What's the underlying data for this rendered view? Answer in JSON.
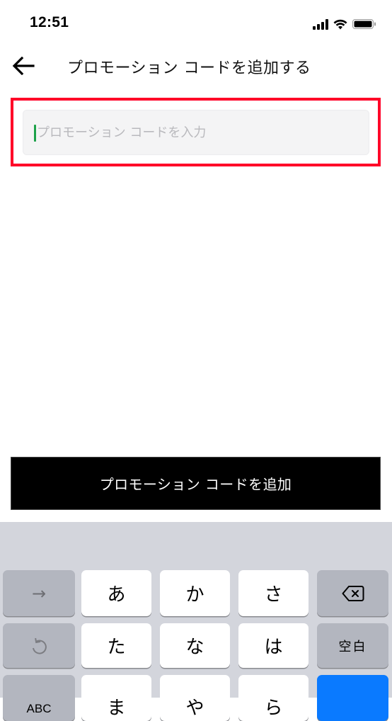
{
  "status_bar": {
    "time": "12:51",
    "icons": [
      "cellular-signal-icon",
      "wifi-icon",
      "battery-icon"
    ]
  },
  "nav": {
    "back_icon": "arrow-left-icon",
    "title": "プロモーション コードを追加する"
  },
  "promo_form": {
    "input_value": "",
    "input_placeholder": "プロモーション コードを入力",
    "submit_label": "プロモーション コードを追加"
  },
  "colors": {
    "highlight_border": "#ff0028",
    "caret": "#1da24a",
    "button_bg": "#000000",
    "keyboard_bg": "#d3d5dc",
    "return_key": "#0a7aff"
  },
  "keyboard": {
    "rows": [
      [
        "→",
        "あ",
        "か",
        "さ",
        "delete"
      ],
      [
        "undo",
        "た",
        "な",
        "は",
        "空白"
      ],
      [
        "ABC",
        "ま",
        "や",
        "ら",
        "return"
      ]
    ],
    "next_label": "→",
    "keys": {
      "a": "あ",
      "ka": "か",
      "sa": "さ",
      "ta": "た",
      "na": "な",
      "ha": "は",
      "ma": "ま",
      "ya": "や",
      "ra": "ら"
    },
    "space_label": "空白",
    "abc_label": "ABC"
  }
}
